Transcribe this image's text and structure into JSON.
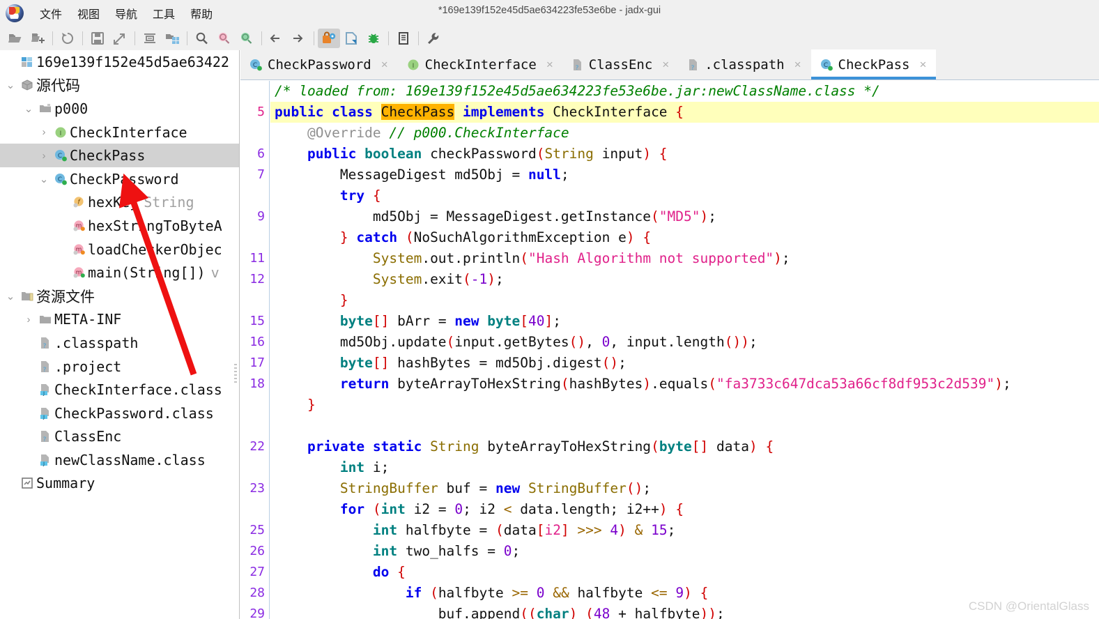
{
  "window": {
    "title": "*169e139f152e45d5ae634223fe53e6be - jadx-gui",
    "app_icon": "jadx-logo-icon"
  },
  "menubar": {
    "items": [
      {
        "label": "文件",
        "name": "menu-file"
      },
      {
        "label": "视图",
        "name": "menu-view"
      },
      {
        "label": "导航",
        "name": "menu-navigation"
      },
      {
        "label": "工具",
        "name": "menu-tools"
      },
      {
        "label": "帮助",
        "name": "menu-help"
      }
    ]
  },
  "toolbar": {
    "buttons": [
      {
        "icon": "open-folder-icon"
      },
      {
        "icon": "add-files-icon"
      },
      {
        "icon": "reload-icon"
      },
      {
        "icon": "save-icon"
      },
      {
        "icon": "save-all-export-icon"
      },
      {
        "icon": "collapse-all-icon"
      },
      {
        "icon": "expand-tree-icon"
      },
      {
        "icon": "search-icon"
      },
      {
        "icon": "search-text-icon"
      },
      {
        "icon": "search-comment-icon"
      },
      {
        "icon": "back-arrow-icon"
      },
      {
        "icon": "forward-arrow-icon"
      },
      {
        "icon": "deobfuscation-icon"
      },
      {
        "icon": "decompile-icon"
      },
      {
        "icon": "debugger-icon"
      },
      {
        "icon": "log-viewer-icon"
      },
      {
        "icon": "preferences-wrench-icon"
      }
    ]
  },
  "sidebar": {
    "items": [
      {
        "label": "169e139f152e45d5ae63422",
        "indent": 0,
        "twisty": "",
        "icon": "jar-root-icon",
        "selected": false
      },
      {
        "label": "源代码",
        "indent": 1,
        "twisty": "down",
        "icon": "sources-package-icon",
        "selected": false
      },
      {
        "label": "p000",
        "indent": 2,
        "twisty": "down",
        "icon": "package-folder-icon",
        "selected": false
      },
      {
        "label": "CheckInterface",
        "indent": 3,
        "twisty": "right",
        "icon": "interface-icon",
        "selected": false
      },
      {
        "label": "CheckPass",
        "indent": 3,
        "twisty": "right",
        "icon": "class-icon",
        "selected": true
      },
      {
        "label": "CheckPassword",
        "indent": 3,
        "twisty": "down",
        "icon": "class-icon",
        "selected": false
      },
      {
        "label": "hexKey",
        "type": "String",
        "indent": 4,
        "twisty": "",
        "icon": "field-icon",
        "selected": false
      },
      {
        "label": "hexStringToByteA",
        "indent": 4,
        "twisty": "",
        "icon": "method-icon",
        "selected": false
      },
      {
        "label": "loadCheckerObjec",
        "indent": 4,
        "twisty": "",
        "icon": "method-icon",
        "selected": false
      },
      {
        "label": "main(String[])",
        "type": "v",
        "indent": 4,
        "twisty": "",
        "icon": "method-icon",
        "selected": false
      },
      {
        "label": "资源文件",
        "indent": 1,
        "twisty": "down",
        "icon": "resources-folder-icon",
        "selected": false
      },
      {
        "label": "META-INF",
        "indent": 2,
        "twisty": "right",
        "icon": "folder-icon",
        "selected": false
      },
      {
        "label": ".classpath",
        "indent": 2,
        "twisty": "",
        "icon": "unknown-file-icon",
        "selected": false
      },
      {
        "label": ".project",
        "indent": 2,
        "twisty": "",
        "icon": "unknown-file-icon",
        "selected": false
      },
      {
        "label": "CheckInterface.class",
        "indent": 2,
        "twisty": "",
        "icon": "java-class-file-icon",
        "selected": false
      },
      {
        "label": "CheckPassword.class",
        "indent": 2,
        "twisty": "",
        "icon": "java-class-file-icon",
        "selected": false
      },
      {
        "label": "ClassEnc",
        "indent": 2,
        "twisty": "",
        "icon": "unknown-file-icon",
        "selected": false
      },
      {
        "label": "newClassName.class",
        "indent": 2,
        "twisty": "",
        "icon": "java-class-file-icon",
        "selected": false
      },
      {
        "label": "Summary",
        "indent": 1,
        "twisty": "",
        "icon": "summary-icon",
        "selected": false
      }
    ]
  },
  "tabs": [
    {
      "label": "CheckPassword",
      "icon": "class-icon",
      "active": false,
      "close": "×"
    },
    {
      "label": "CheckInterface",
      "icon": "interface-icon",
      "active": false,
      "close": "×"
    },
    {
      "label": "ClassEnc",
      "icon": "unknown-file-icon",
      "active": false,
      "close": "×"
    },
    {
      "label": ".classpath",
      "icon": "unknown-file-icon",
      "active": false,
      "close": "×"
    },
    {
      "label": "CheckPass",
      "icon": "class-icon",
      "active": true,
      "close": "×"
    }
  ],
  "editor": {
    "selected_token": "CheckPass",
    "gutter": [
      "",
      "5",
      "",
      "6",
      "7",
      "",
      "9",
      "",
      "11",
      "12",
      "",
      "15",
      "16",
      "17",
      "18",
      "",
      "",
      "22",
      "",
      "23",
      "",
      "25",
      "26",
      "27",
      "28",
      "29"
    ],
    "current_line_index": 1,
    "highlight_line_index": 1,
    "lines": [
      "/* loaded from: 169e139f152e45d5ae634223fe53e6be.jar:newClassName.class */",
      "public class CheckPass implements CheckInterface {",
      "    @Override // p000.CheckInterface",
      "    public boolean checkPassword(String input) {",
      "        MessageDigest md5Obj = null;",
      "        try {",
      "            md5Obj = MessageDigest.getInstance(\"MD5\");",
      "        } catch (NoSuchAlgorithmException e) {",
      "            System.out.println(\"Hash Algorithm not supported\");",
      "            System.exit(-1);",
      "        }",
      "        byte[] bArr = new byte[40];",
      "        md5Obj.update(input.getBytes(), 0, input.length());",
      "        byte[] hashBytes = md5Obj.digest();",
      "        return byteArrayToHexString(hashBytes).equals(\"fa3733c647dca53a66cf8df953c2d539\");",
      "    }",
      "",
      "    private static String byteArrayToHexString(byte[] data) {",
      "        int i;",
      "        StringBuffer buf = new StringBuffer();",
      "        for (int i2 = 0; i2 < data.length; i2++) {",
      "            int halfbyte = (data[i2] >>> 4) & 15;",
      "            int two_halfs = 0;",
      "            do {",
      "                if (halfbyte >= 0 && halfbyte <= 9) {",
      "                    buf.append((char) (48 + halfbyte));"
    ],
    "md5_literal": "fa3733c647dca53a66cf8df953c2d539",
    "loaded_from_comment": "/* loaded from: 169e139f152e45d5ae634223fe53e6be.jar:newClassName.class */"
  },
  "annotation": {
    "type": "red-arrow",
    "points_to": "CheckPassword"
  },
  "watermark": {
    "text": "CSDN @OrientalGlass"
  },
  "colors": {
    "accent": "#3c92d8",
    "highlight_line": "#ffffbb",
    "selection": "#ffb300",
    "keyword": "#0000ee",
    "string": "#e0218a",
    "comment": "#008000",
    "type": "#8a6d00",
    "number": "#7a00cc",
    "punct": "#d00000",
    "gutter_num": "#8a2be2",
    "annotation_red": "#ee1111"
  }
}
